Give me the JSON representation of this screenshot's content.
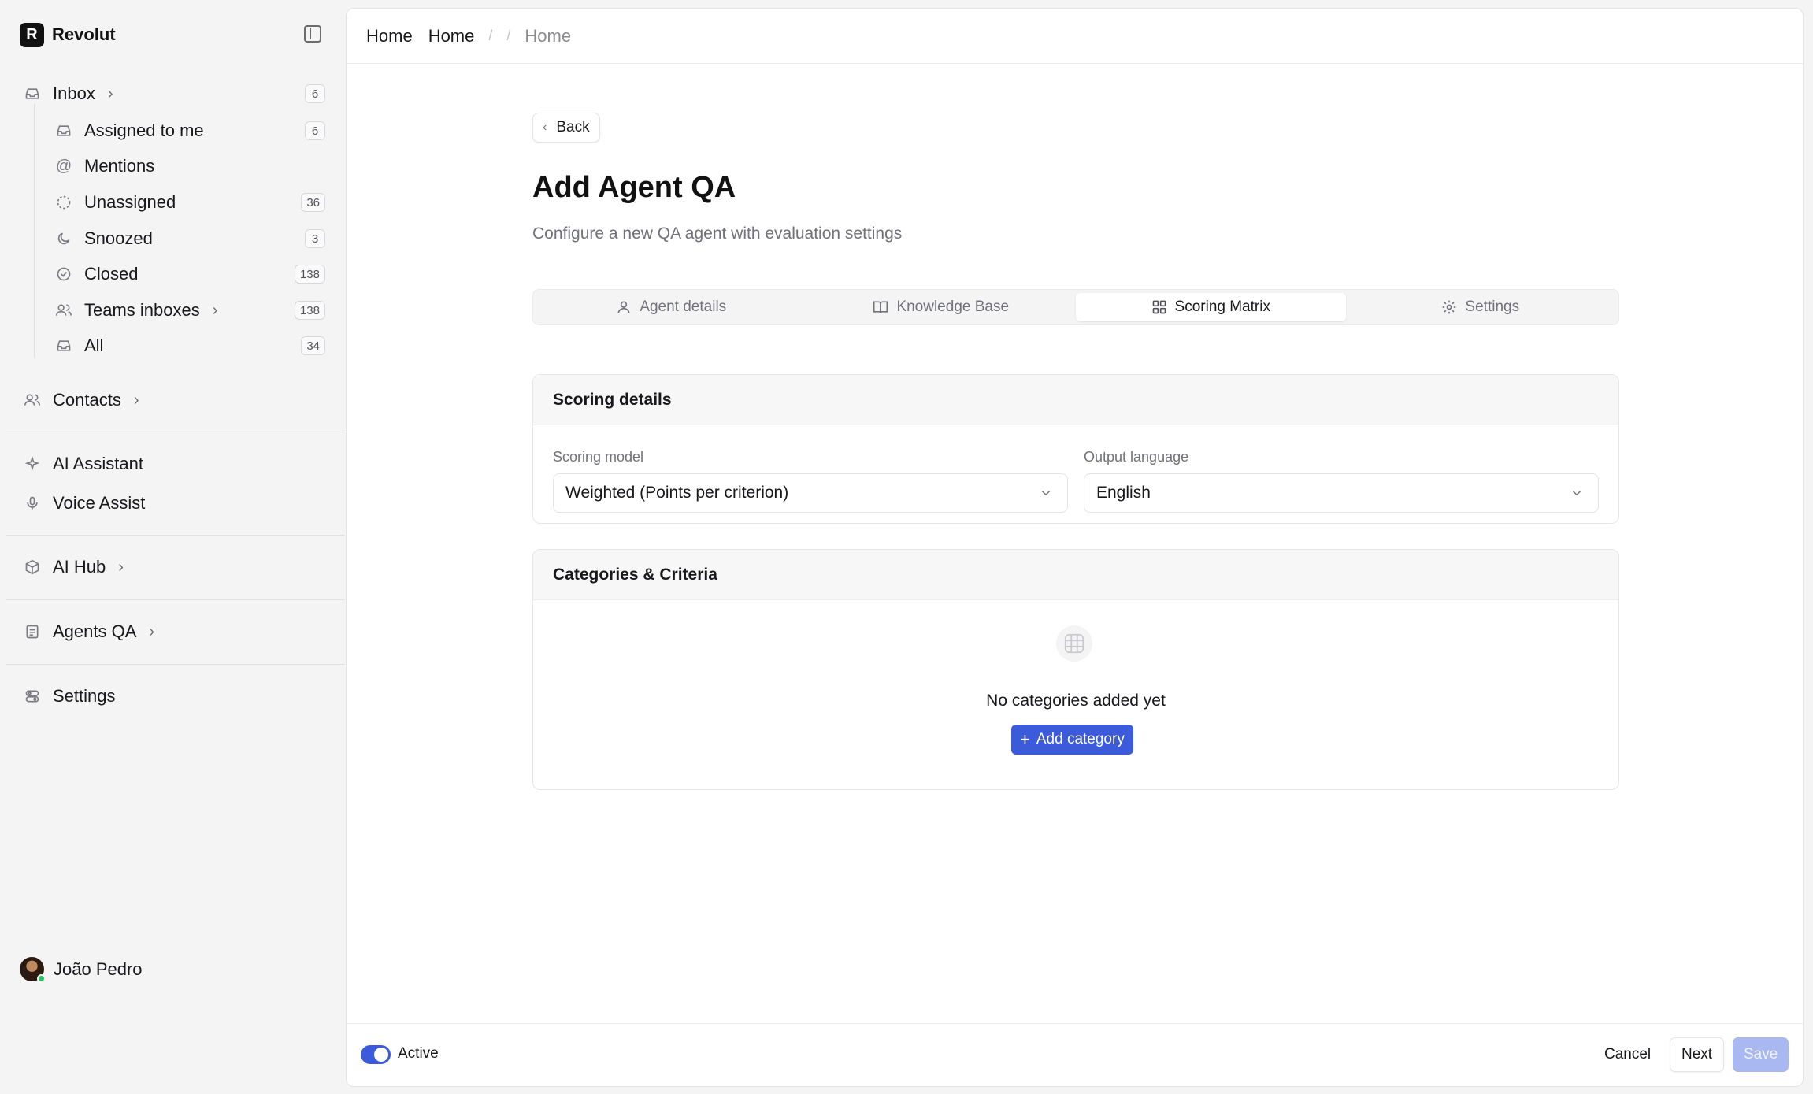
{
  "brand": {
    "logo_letter": "R",
    "name": "Revolut"
  },
  "sidebar": {
    "inbox": {
      "label": "Inbox",
      "count": "6"
    },
    "inbox_items": [
      {
        "label": "Assigned to me",
        "count": "6"
      },
      {
        "label": "Mentions",
        "count": ""
      },
      {
        "label": "Unassigned",
        "count": "36"
      },
      {
        "label": "Snoozed",
        "count": "3"
      },
      {
        "label": "Closed",
        "count": "138"
      },
      {
        "label": "Teams inboxes",
        "count": "138"
      },
      {
        "label": "All",
        "count": "34"
      }
    ],
    "contacts": "Contacts",
    "ai_assistant": "AI Assistant",
    "voice_assist": "Voice Assist",
    "ai_hub": "AI Hub",
    "agents_qa": "Agents QA",
    "settings": "Settings"
  },
  "user": {
    "name": "João Pedro"
  },
  "breadcrumb": {
    "first": "Home",
    "second": "Home",
    "separator": "/",
    "current": "Home"
  },
  "page": {
    "back_label": "Back",
    "title": "Add Agent QA",
    "subtitle": "Configure a new QA agent with evaluation settings"
  },
  "tabs": [
    {
      "label": "Agent details",
      "icon": "user-icon"
    },
    {
      "label": "Knowledge Base",
      "icon": "book-icon"
    },
    {
      "label": "Scoring Matrix",
      "icon": "grid-icon",
      "active": true
    },
    {
      "label": "Settings",
      "icon": "gear-icon"
    }
  ],
  "scoring": {
    "title": "Scoring details",
    "model_label": "Scoring model",
    "model_value": "Weighted (Points per criterion)",
    "language_label": "Output language",
    "language_value": "English"
  },
  "categories": {
    "title": "Categories & Criteria",
    "empty_text": "No categories added yet",
    "add_label": "Add category"
  },
  "footer": {
    "toggle_label": "Active",
    "toggle_on": true,
    "cancel_label": "Cancel",
    "next_label": "Next",
    "save_label": "Save"
  },
  "colors": {
    "accent": "#3b5bdb",
    "save_disabled": "#a9b8f0"
  }
}
